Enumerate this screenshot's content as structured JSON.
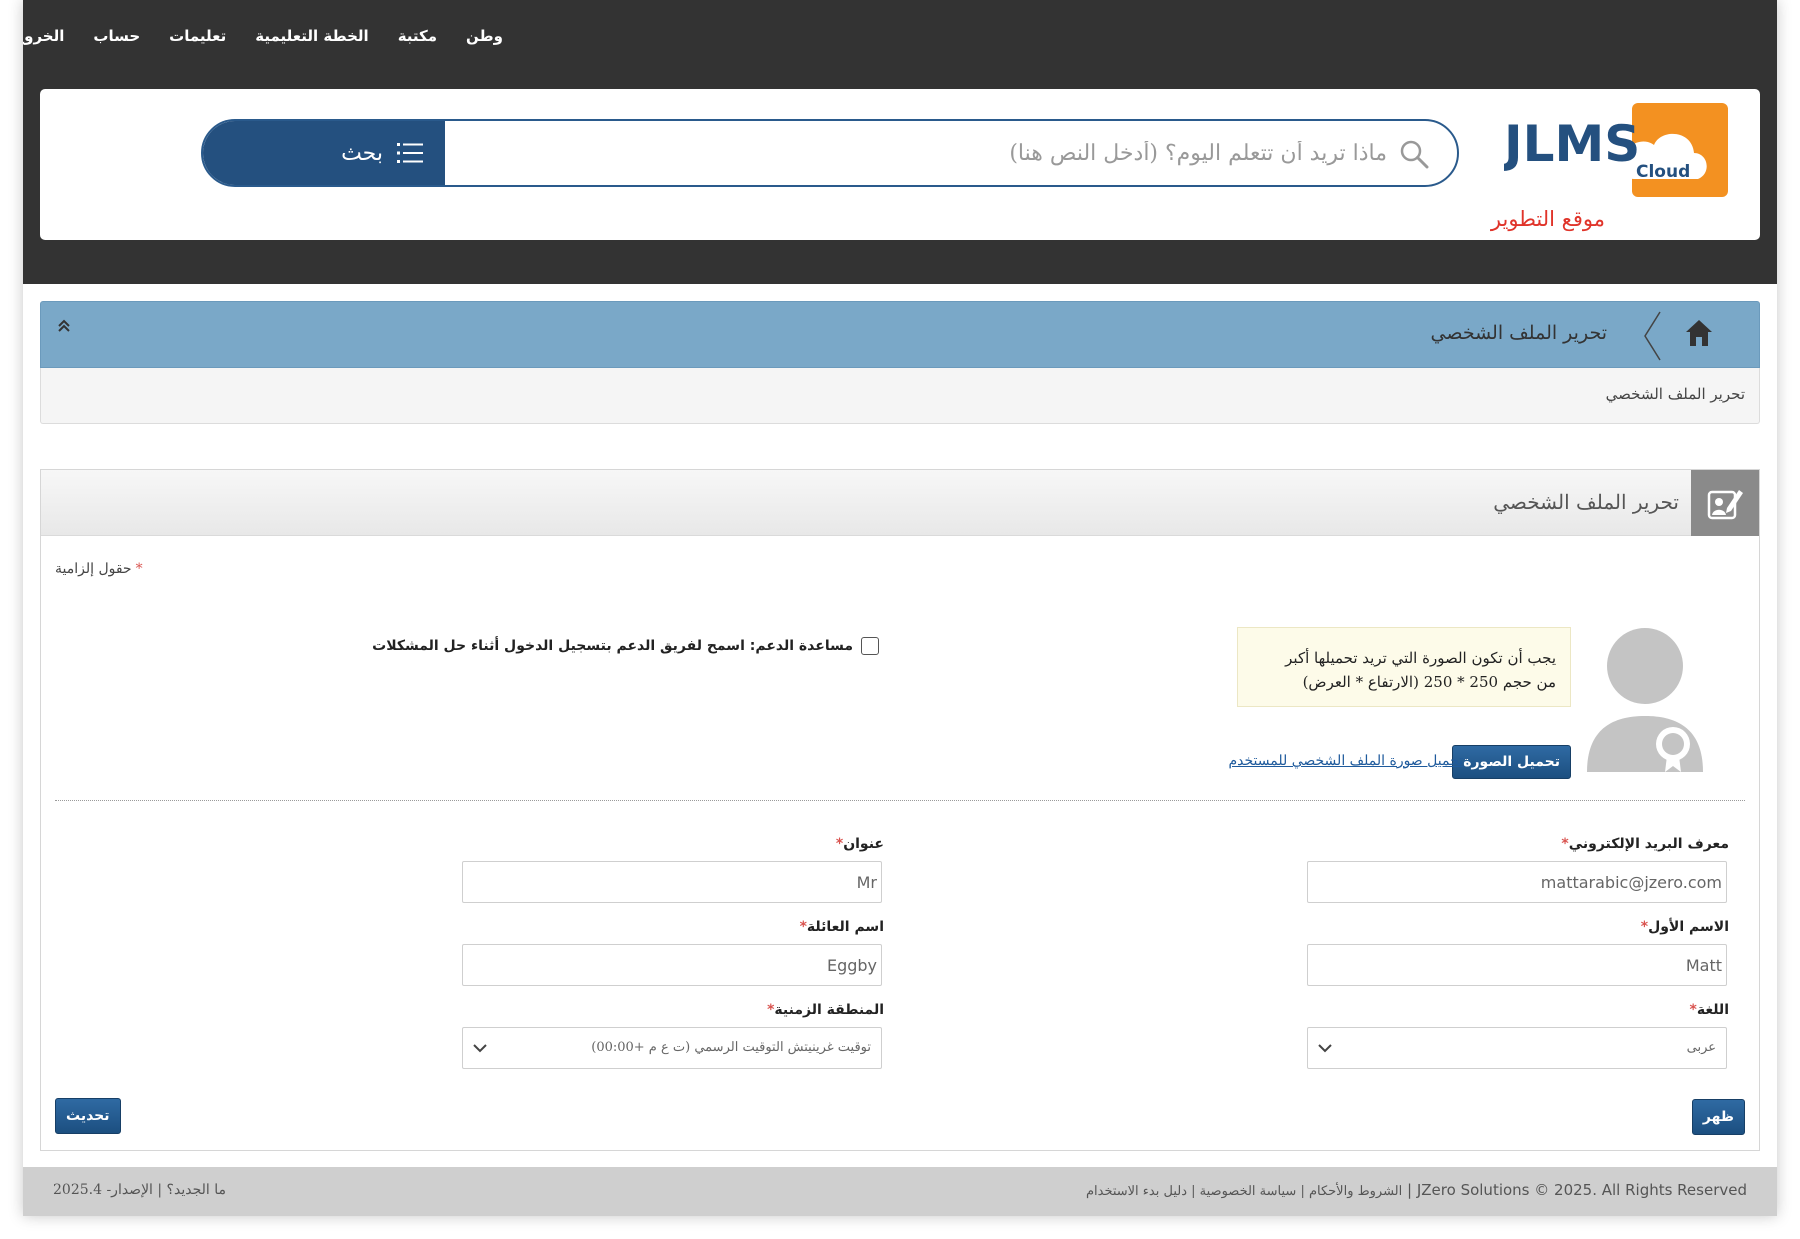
{
  "top_nav": [
    "وطن",
    "مكتبة",
    "الخطة التعليمية",
    "تعليمات",
    "حساب",
    "الخروج"
  ],
  "logo": {
    "text": "JLMS",
    "subtext": "Cloud"
  },
  "dev_site_label": "موقع التطوير",
  "search": {
    "placeholder": "ماذا تريد أن تتعلم اليوم؟ (أدخل النص هنا)",
    "button_label": "بحث"
  },
  "breadcrumb": {
    "current": "تحرير الملف الشخصي",
    "sub": "تحرير الملف الشخصي"
  },
  "panel": {
    "title": "تحرير الملف الشخصي",
    "mandatory_fields": "حقول إلزامية",
    "image_note_line1": "يجب أن تكون الصورة التي تريد تحميلها أكبر",
    "image_note_line2": "من حجم 250 * 250 (الارتفاع * العرض)",
    "upload_button": "تحميل الصورة",
    "upload_link": "تحميل صورة الملف الشخصي للمستخدم",
    "support_label": "مساعدة الدعم: اسمح لفريق الدعم بتسجيل الدخول أثناء حل المشكلات"
  },
  "form": {
    "email_label": "معرف البريد الإلكتروني",
    "email_value": "mattarabic@jzero.com",
    "title_label": "عنوان",
    "title_value": "Mr",
    "first_name_label": "الاسم الأول",
    "first_name_value": "Matt",
    "family_name_label": "اسم العائلة",
    "family_name_value": "Eggby",
    "language_label": "اللغة",
    "language_value": "عربى",
    "timezone_label": "المنطقة الزمنية",
    "timezone_value": "توقيت غرينيتش التوقيت الرسمي (ت ع م +00:00)"
  },
  "buttons": {
    "show": "ظهر",
    "update": "تحديث"
  },
  "footer": {
    "copyright": "JZero Solutions © 2025. All Rights Reserved",
    "links": "الشروط والأحكام | سياسة الخصوصية | دليل بدء الاستخدام",
    "version": "ما الجديد؟ | الإصدار- 2025.4"
  },
  "colors": {
    "header_bg": "#333333",
    "primary_blue": "#24507f",
    "crumb_bar": "#7aa8c8",
    "dev_red": "#e0342a",
    "logo_orange": "#f39121"
  }
}
